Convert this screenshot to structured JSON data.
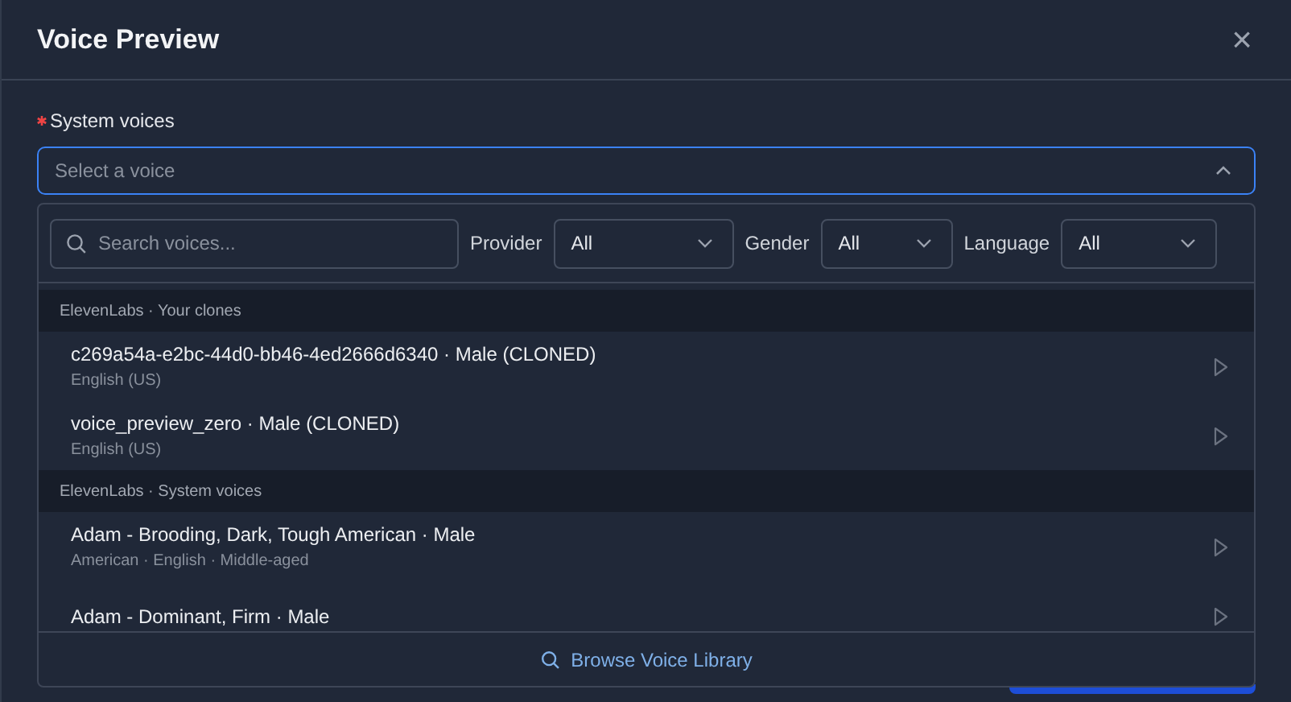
{
  "dialog": {
    "title": "Voice Preview",
    "close": "×"
  },
  "field": {
    "label": "System voices",
    "required": true,
    "placeholder": "Select a voice",
    "expanded": true
  },
  "dropdown": {
    "search": {
      "placeholder": "Search voices..."
    },
    "filters": [
      {
        "label": "Provider",
        "value": "All"
      },
      {
        "label": "Gender",
        "value": "All"
      },
      {
        "label": "Language",
        "value": "All"
      }
    ],
    "groups": [
      {
        "title": "ElevenLabs · Your clones",
        "voices": [
          {
            "name": "c269a54a-e2bc-44d0-bb46-4ed2666d6340 · Male (CLONED)",
            "detail": "English (US)"
          },
          {
            "name": "voice_preview_zero · Male (CLONED)",
            "detail": "English (US)"
          }
        ]
      },
      {
        "title": "ElevenLabs · System voices",
        "voices": [
          {
            "name": "Adam - Brooding, Dark, Tough American · Male",
            "detail": "American · English · Middle-aged"
          },
          {
            "name": "Adam - Dominant, Firm · Male"
          }
        ]
      }
    ],
    "footer_link": "Browse Voice Library"
  }
}
